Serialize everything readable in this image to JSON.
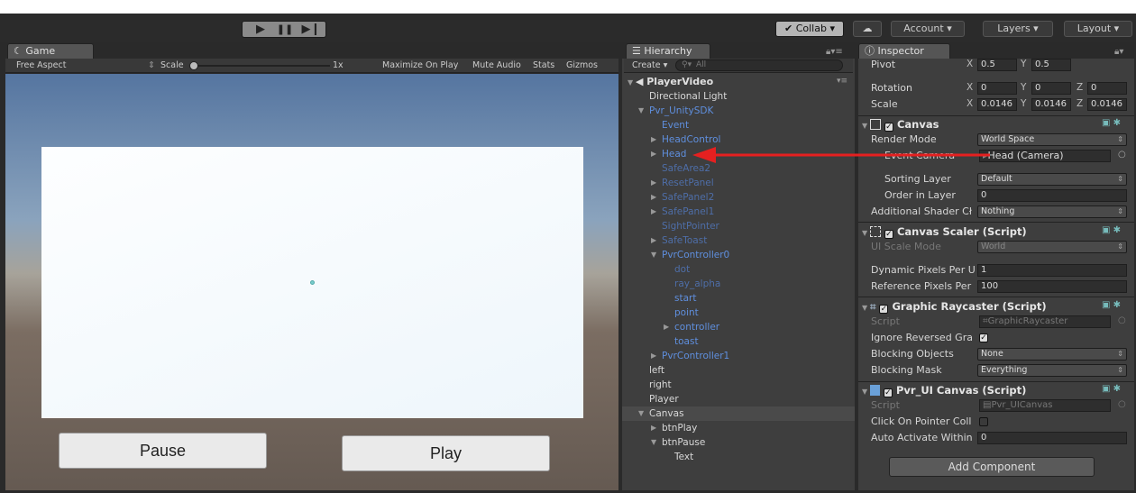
{
  "toolbar": {
    "play_icon": "play-icon",
    "pause_icon": "pause-icon",
    "step_icon": "step-icon",
    "collab": "✔ Collab ▾",
    "cloud": "cloud-icon",
    "account": "Account ▾",
    "layers": "Layers ▾",
    "layout": "Layout ▾"
  },
  "game": {
    "tab": "Game",
    "aspect": "Free Aspect",
    "scale_label": "Scale",
    "scale_value": "1x",
    "maximize": "Maximize On Play",
    "mute": "Mute Audio",
    "stats": "Stats",
    "gizmos": "Gizmos",
    "btn_pause": "Pause",
    "btn_play": "Play"
  },
  "hierarchy": {
    "tab": "Hierarchy",
    "create": "Create ▾",
    "search_placeholder": "All",
    "scene": "PlayerVideo",
    "items": [
      {
        "label": "Directional Light"
      },
      {
        "label": "Pvr_UnitySDK"
      },
      {
        "label": "Event"
      },
      {
        "label": "HeadControl"
      },
      {
        "label": "Head"
      },
      {
        "label": "SafeArea2"
      },
      {
        "label": "ResetPanel"
      },
      {
        "label": "SafePanel2"
      },
      {
        "label": "SafePanel1"
      },
      {
        "label": "SightPointer"
      },
      {
        "label": "SafeToast"
      },
      {
        "label": "PvrController0"
      },
      {
        "label": "dot"
      },
      {
        "label": "ray_alpha"
      },
      {
        "label": "start"
      },
      {
        "label": "point"
      },
      {
        "label": "controller"
      },
      {
        "label": "toast"
      },
      {
        "label": "PvrController1"
      },
      {
        "label": "left"
      },
      {
        "label": "right"
      },
      {
        "label": "Player"
      },
      {
        "label": "Canvas"
      },
      {
        "label": "btnPlay"
      },
      {
        "label": "btnPause"
      },
      {
        "label": "Text"
      }
    ]
  },
  "inspector": {
    "tab": "Inspector",
    "pivot": {
      "label": "Pivot",
      "x": "0.5",
      "y": "0.5"
    },
    "rotation": {
      "label": "Rotation",
      "x": "0",
      "y": "0",
      "z": "0"
    },
    "scale": {
      "label": "Scale",
      "x": "0.0146",
      "y": "0.0146",
      "z": "0.0146"
    },
    "canvas": {
      "title": "Canvas",
      "render_mode_label": "Render Mode",
      "render_mode": "World Space",
      "event_camera_label": "Event Camera",
      "event_camera": "Head (Camera)",
      "sorting_layer_label": "Sorting Layer",
      "sorting_layer": "Default",
      "order_label": "Order in Layer",
      "order": "0",
      "shader_label": "Additional Shader Cł",
      "shader": "Nothing"
    },
    "scaler": {
      "title": "Canvas Scaler (Script)",
      "ui_scale_label": "UI Scale Mode",
      "ui_scale": "World",
      "dyn_label": "Dynamic Pixels Per U",
      "dyn": "1",
      "ref_label": "Reference Pixels Per",
      "ref": "100"
    },
    "raycaster": {
      "title": "Graphic Raycaster (Script)",
      "script_label": "Script",
      "script": "GraphicRaycaster",
      "ignore_label": "Ignore Reversed Gra",
      "blocking_label": "Blocking Objects",
      "blocking": "None",
      "mask_label": "Blocking Mask",
      "mask": "Everything"
    },
    "pvr": {
      "title": "Pvr_UI Canvas (Script)",
      "script_label": "Script",
      "script": "Pvr_UICanvas",
      "click_label": "Click On Pointer Coll",
      "auto_label": "Auto Activate Within",
      "auto": "0"
    },
    "add_component": "Add Component"
  }
}
